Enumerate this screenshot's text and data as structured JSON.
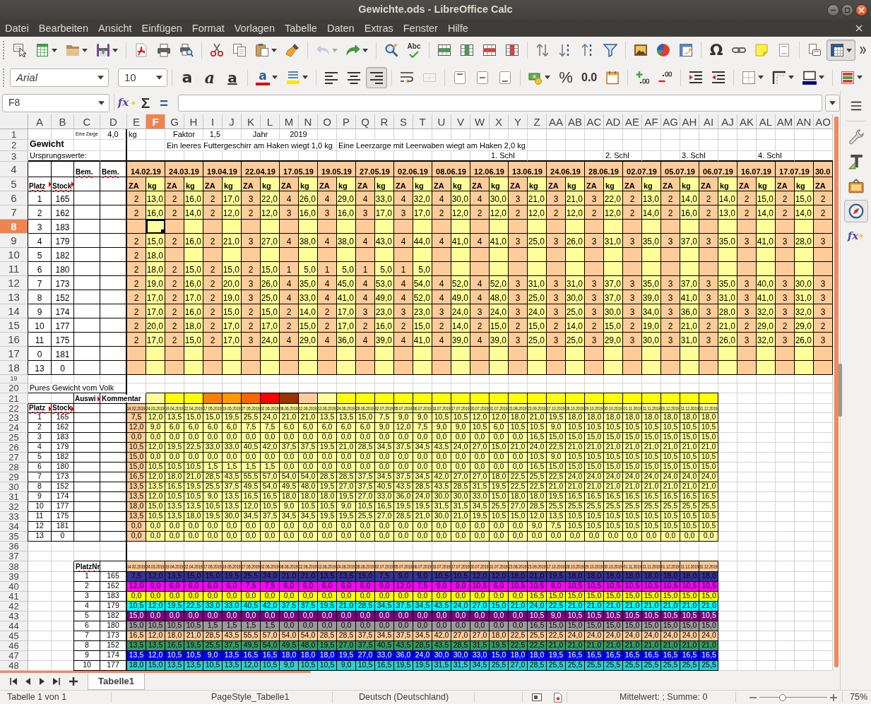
{
  "window": {
    "title": "Gewichte.ods - LibreOffice Calc"
  },
  "menu": [
    "Datei",
    "Bearbeiten",
    "Ansicht",
    "Einfügen",
    "Format",
    "Vorlagen",
    "Tabelle",
    "Daten",
    "Extras",
    "Fenster",
    "Hilfe"
  ],
  "standard_toolbar": {
    "undo": {
      "disabled": true
    },
    "redo": {
      "disabled": false
    },
    "spelling": {
      "label": "Abc"
    },
    "special_character": {
      "label": "Ω"
    },
    "freeze_panes": {
      "pressed": true
    }
  },
  "formatting_toolbar": {
    "font_name": "Arial",
    "font_size": "10",
    "bold": {
      "label": "a"
    },
    "italic": {
      "label": "a"
    },
    "underline": {
      "label": "a"
    },
    "font_color": {
      "label": "a"
    },
    "alignment": [
      {
        "pressed": false
      },
      {
        "pressed": false
      },
      {
        "pressed": true
      }
    ],
    "merge": {
      "disabled": true
    },
    "percent": {
      "label": "%"
    },
    "number": {
      "label": "0.0"
    }
  },
  "formula_bar": {
    "name_box": "F8",
    "function_wizard": {
      "label": "fx"
    },
    "sum": {
      "label": "Σ"
    },
    "function": {
      "label": "="
    }
  },
  "sheet": {
    "column_headers": [
      {
        "label": "A",
        "selected": false
      },
      {
        "label": "B",
        "selected": false
      },
      {
        "label": "C",
        "selected": false
      },
      {
        "label": "D",
        "selected": false
      },
      {
        "label": "E",
        "selected": false
      },
      {
        "label": "F",
        "selected": true
      },
      {
        "label": "G",
        "selected": false
      },
      {
        "label": "H",
        "selected": false
      },
      {
        "label": "I",
        "selected": false
      },
      {
        "label": "J",
        "selected": false
      },
      {
        "label": "K",
        "selected": false
      },
      {
        "label": "L",
        "selected": false
      },
      {
        "label": "M",
        "selected": false
      },
      {
        "label": "N",
        "selected": false
      },
      {
        "label": "O",
        "selected": false
      },
      {
        "label": "P",
        "selected": false
      },
      {
        "label": "Q",
        "selected": false
      },
      {
        "label": "R",
        "selected": false
      },
      {
        "label": "S",
        "selected": false
      },
      {
        "label": "T",
        "selected": false
      },
      {
        "label": "U",
        "selected": false
      },
      {
        "label": "V",
        "selected": false
      },
      {
        "label": "W",
        "selected": false
      },
      {
        "label": "X",
        "selected": false
      },
      {
        "label": "Y",
        "selected": false
      },
      {
        "label": "Z",
        "selected": false
      },
      {
        "label": "AA",
        "selected": false
      },
      {
        "label": "AB",
        "selected": false
      },
      {
        "label": "AC",
        "selected": false
      },
      {
        "label": "AD",
        "selected": false
      },
      {
        "label": "AE",
        "selected": false
      },
      {
        "label": "AF",
        "selected": false
      },
      {
        "label": "AG",
        "selected": false
      },
      {
        "label": "AH",
        "selected": false
      },
      {
        "label": "AI",
        "selected": false
      },
      {
        "label": "AJ",
        "selected": false
      },
      {
        "label": "AK",
        "selected": false
      },
      {
        "label": "AL",
        "selected": false
      },
      {
        "label": "AM",
        "selected": false
      },
      {
        "label": "AN",
        "selected": false
      },
      {
        "label": "AO",
        "selected": false
      }
    ],
    "row_headers": [
      {
        "label": "1",
        "selected": false
      },
      {
        "label": "2",
        "selected": false
      },
      {
        "label": "3",
        "selected": false
      },
      {
        "label": "4",
        "selected": false
      },
      {
        "label": "5",
        "selected": false
      },
      {
        "label": "6",
        "selected": false
      },
      {
        "label": "7",
        "selected": false
      },
      {
        "label": "8",
        "selected": true
      },
      {
        "label": "9",
        "selected": false
      },
      {
        "label": "10",
        "selected": false
      },
      {
        "label": "11",
        "selected": false
      },
      {
        "label": "12",
        "selected": false
      },
      {
        "label": "13",
        "selected": false
      },
      {
        "label": "14",
        "selected": false
      },
      {
        "label": "15",
        "selected": false
      },
      {
        "label": "16",
        "selected": false
      },
      {
        "label": "17",
        "selected": false
      },
      {
        "label": "18",
        "selected": false
      },
      {
        "label": "19",
        "selected": false
      },
      {
        "label": "20",
        "selected": false
      },
      {
        "label": "21",
        "selected": false
      },
      {
        "label": "22",
        "selected": false
      },
      {
        "label": "23",
        "selected": false
      },
      {
        "label": "24",
        "selected": false
      },
      {
        "label": "25",
        "selected": false
      },
      {
        "label": "26",
        "selected": false
      },
      {
        "label": "27",
        "selected": false
      },
      {
        "label": "28",
        "selected": false
      },
      {
        "label": "29",
        "selected": false
      },
      {
        "label": "30",
        "selected": false
      },
      {
        "label": "31",
        "selected": false
      },
      {
        "label": "32",
        "selected": false
      },
      {
        "label": "33",
        "selected": false
      },
      {
        "label": "34",
        "selected": false
      },
      {
        "label": "35",
        "selected": false
      },
      {
        "label": "36",
        "selected": false
      },
      {
        "label": "37",
        "selected": false
      },
      {
        "label": "38",
        "selected": false
      },
      {
        "label": "39",
        "selected": false
      },
      {
        "label": "40",
        "selected": false
      },
      {
        "label": "41",
        "selected": false
      },
      {
        "label": "42",
        "selected": false
      },
      {
        "label": "43",
        "selected": false
      },
      {
        "label": "44",
        "selected": false
      },
      {
        "label": "45",
        "selected": false
      },
      {
        "label": "46",
        "selected": false
      },
      {
        "label": "47",
        "selected": false
      },
      {
        "label": "48",
        "selected": false
      }
    ],
    "info": {
      "zarge": {
        "label": "Eine Zarge",
        "value": "4,0",
        "unit": "kg"
      },
      "factor": {
        "label": "Faktor",
        "value": "1,5"
      },
      "year": {
        "label": "Jahr",
        "value": "2019"
      },
      "title": "Gewicht",
      "notes": [
        "Ein leeres Futtergeschirr am Haken wiegt 1,0 kg",
        "Eine Leerzarge mit Leerwaben wiegt am Haken 2,0 kg"
      ],
      "origin_label": "Ursprungswerte:",
      "markers": [
        "1. Schl",
        "2. Schl",
        "3. Schl",
        "4. Schl"
      ]
    },
    "weights": {
      "remark_headers": [
        {
          "text": "Bem.",
          "misspelled": true,
          "clipped": false
        },
        {
          "text": "Bem.",
          "misspelled": true,
          "clipped": false
        }
      ],
      "dates": [
        "14.02.19",
        "24.03.19",
        "19.04.19",
        "22.04.19",
        "17.05.19",
        "19.05.19",
        "27.05.19",
        "02.06.19",
        "08.06.19",
        "12.06.19",
        "13.06.19",
        "24.06.19",
        "28.06.19",
        "02.07.19",
        "05.07.19",
        "06.07.19",
        "16.07.19",
        "17.07.19",
        "30.0"
      ],
      "key_headers": [
        {
          "text": "Platz",
          "misspelled": true,
          "clipped": true
        },
        {
          "text": "Stock",
          "misspelled": true,
          "clipped": true
        }
      ],
      "units": [
        "ZA",
        "kg",
        "ZA",
        "kg",
        "ZA",
        "kg",
        "ZA",
        "kg",
        "ZA",
        "kg",
        "ZA",
        "kg",
        "ZA",
        "kg",
        "ZA",
        "kg",
        "ZA",
        "kg",
        "ZA",
        "kg",
        "ZA",
        "kg",
        "ZA",
        "kg",
        "ZA",
        "kg",
        "ZA",
        "kg",
        "ZA",
        "kg",
        "ZA",
        "kg",
        "ZA",
        "kg",
        "ZA",
        "kg",
        "ZA"
      ],
      "rows": [
        {
          "platz": "1",
          "stock": "165",
          "values": [
            "2",
            "13,0",
            "2",
            "16,0",
            "2",
            "17,0",
            "3",
            "22,0",
            "4",
            "26,0",
            "4",
            "29,0",
            "4",
            "33,0",
            "4",
            "32,0",
            "4",
            "30,0",
            "4",
            "30,0",
            "3",
            "21,0",
            "3",
            "21,0",
            "3",
            "22,0",
            "2",
            "13,0",
            "2",
            "14,0",
            "2",
            "14,0",
            "2",
            "15,0",
            "2",
            "15,0",
            "2"
          ]
        },
        {
          "platz": "2",
          "stock": "162",
          "values": [
            "2",
            "16,0",
            "2",
            "14,0",
            "2",
            "12,0",
            "2",
            "12,0",
            "3",
            "16,0",
            "3",
            "16,0",
            "3",
            "17,0",
            "3",
            "17,0",
            "2",
            "12,0",
            "2",
            "12,0",
            "2",
            "12,0",
            "2",
            "12,0",
            "2",
            "12,0",
            "2",
            "14,0",
            "2",
            "16,0",
            "2",
            "13,0",
            "2",
            "14,0",
            "2",
            "14,0",
            "2"
          ]
        },
        {
          "platz": "3",
          "stock": "183"
        },
        {
          "platz": "4",
          "stock": "179",
          "values": [
            "2",
            "15,0",
            "2",
            "16,0",
            "2",
            "21,0",
            "3",
            "27,0",
            "4",
            "38,0",
            "4",
            "38,0",
            "4",
            "43,0",
            "4",
            "44,0",
            "4",
            "41,0",
            "4",
            "41,0",
            "3",
            "25,0",
            "3",
            "26,0",
            "3",
            "31,0",
            "3",
            "35,0",
            "3",
            "37,0",
            "3",
            "35,0",
            "3",
            "41,0",
            "3",
            "28,0",
            "3"
          ]
        },
        {
          "platz": "5",
          "stock": "182",
          "values": [
            "2",
            "18,0"
          ]
        },
        {
          "platz": "6",
          "stock": "180",
          "values": [
            "2",
            "18,0",
            "2",
            "15,0",
            "2",
            "15,0",
            "2",
            "15,0",
            "1",
            "5,0",
            "1",
            "5,0",
            "1",
            "5,0",
            "1",
            "5,0"
          ]
        },
        {
          "platz": "7",
          "stock": "173",
          "values": [
            "2",
            "19,0",
            "2",
            "16,0",
            "2",
            "20,0",
            "3",
            "26,0",
            "4",
            "35,0",
            "4",
            "45,0",
            "4",
            "53,0",
            "4",
            "54,0",
            "4",
            "52,0",
            "4",
            "52,0",
            "3",
            "31,0",
            "3",
            "31,0",
            "3",
            "37,0",
            "3",
            "35,0",
            "3",
            "37,0",
            "3",
            "35,0",
            "3",
            "40,0",
            "3",
            "30,0",
            "3"
          ]
        },
        {
          "platz": "8",
          "stock": "152",
          "values": [
            "2",
            "17,0",
            "2",
            "17,0",
            "2",
            "19,0",
            "3",
            "25,0",
            "4",
            "33,0",
            "4",
            "41,0",
            "4",
            "49,0",
            "4",
            "52,0",
            "4",
            "49,0",
            "4",
            "48,0",
            "3",
            "25,0",
            "3",
            "30,0",
            "3",
            "37,0",
            "3",
            "39,0",
            "3",
            "41,0",
            "3",
            "31,0",
            "3",
            "41,0",
            "3",
            "31,0",
            "3"
          ]
        },
        {
          "platz": "9",
          "stock": "174",
          "values": [
            "2",
            "17,0",
            "2",
            "16,0",
            "2",
            "15,0",
            "2",
            "15,0",
            "2",
            "14,0",
            "2",
            "17,0",
            "3",
            "23,0",
            "3",
            "23,0",
            "3",
            "24,0",
            "3",
            "24,0",
            "3",
            "24,0",
            "3",
            "25,0",
            "3",
            "30,0",
            "3",
            "34,0",
            "3",
            "36,0",
            "3",
            "28,0",
            "3",
            "32,0",
            "3",
            "32,0",
            "3"
          ]
        },
        {
          "platz": "10",
          "stock": "177",
          "values": [
            "2",
            "20,0",
            "2",
            "18,0",
            "2",
            "17,0",
            "2",
            "17,0",
            "2",
            "15,0",
            "2",
            "17,0",
            "2",
            "16,0",
            "2",
            "15,0",
            "2",
            "14,0",
            "2",
            "15,0",
            "2",
            "15,0",
            "2",
            "14,0",
            "2",
            "15,0",
            "2",
            "19,0",
            "2",
            "21,0",
            "2",
            "21,0",
            "2",
            "29,0",
            "2",
            "29,0",
            "2"
          ]
        },
        {
          "platz": "11",
          "stock": "175",
          "values": [
            "2",
            "17,0",
            "2",
            "15,0",
            "2",
            "17,0",
            "3",
            "24,0",
            "4",
            "29,0",
            "4",
            "36,0",
            "4",
            "39,0",
            "4",
            "41,0",
            "4",
            "39,0",
            "4",
            "39,0",
            "3",
            "25,0",
            "3",
            "25,0",
            "3",
            "29,0",
            "3",
            "30,0",
            "3",
            "31,0",
            "3",
            "26,0",
            "3",
            "32,0",
            "3",
            "26,0",
            "3"
          ]
        },
        {
          "platz": "0",
          "stock": "181"
        },
        {
          "platz": "13",
          "stock": "0"
        }
      ]
    },
    "net": {
      "title": "Pures Gewicht vom Volk",
      "comment_headers": [
        {
          "text": "Auswi",
          "misspelled": false,
          "clipped": true
        },
        {
          "text": "Kommentar",
          "misspelled": false,
          "clipped": false
        }
      ],
      "color_cells": [
        {
          "color": "#ffff99"
        },
        {
          "color": "#ffff00"
        },
        {
          "color": "#ffff00"
        },
        {
          "color": "#ff8000"
        },
        {
          "color": "#ff9900"
        },
        {
          "color": "#ff6600"
        },
        {
          "color": "#ff0000"
        },
        {
          "color": "#993300"
        },
        {
          "color": "#ffcc99"
        },
        {
          "color": "#ffff99"
        },
        {
          "color": "#ffff00"
        },
        {
          "color": "#ffff00"
        },
        {
          "color": "#ffff00"
        },
        {
          "color": "#ffff00"
        },
        {
          "color": "#ffff00"
        },
        {
          "color": "#ffff00"
        },
        {
          "color": "#ffff00"
        },
        {
          "color": "#ffff00"
        },
        {
          "color": "#ffff00"
        },
        {
          "color": "#ffff00"
        },
        {
          "color": "#ffff00"
        },
        {
          "color": "#ffff00"
        },
        {
          "color": "#ffff00"
        },
        {
          "color": "#ffff00"
        },
        {
          "color": "#ffff00"
        },
        {
          "color": "#ffff00"
        },
        {
          "color": "#ffff00"
        },
        {
          "color": "#ffff00"
        },
        {
          "color": "#ffff00"
        },
        {
          "color": "#ffff00"
        }
      ],
      "key_headers": [
        {
          "text": "Platz",
          "misspelled": true,
          "clipped": true
        },
        {
          "text": "Stock",
          "misspelled": true,
          "clipped": true
        }
      ],
      "dates": [
        "14.02.2019",
        "24.03.2019",
        "19.04.2019",
        "22.04.2019",
        "17.05.2019",
        "19.05.2019",
        "27.05.2019",
        "02.06.2019",
        "08.06.2019",
        "12.06.2019",
        "13.06.2019",
        "24.06.2019",
        "28.06.2019",
        "02.07.2019",
        "05.07.2019",
        "06.07.2019",
        "16.07.2019",
        "17.07.2019",
        "30.07.2019",
        "31.07.2019",
        "23.08.2019",
        "23.09.2019",
        "17.10.2019",
        "28.10.2019",
        "29.10.2019",
        "30.10.2019",
        "01.11.2019",
        "11.11.2019",
        "01.12.2019",
        "11.12.2019",
        "31.12.2019"
      ],
      "rows": [
        {
          "platz": "1",
          "stock": "165",
          "values": [
            "7,5",
            "12,0",
            "13,5",
            "15,0",
            "15,0",
            "19,5",
            "25,5",
            "24,0",
            "21,0",
            "21,0",
            "13,5",
            "13,5",
            "15,0",
            "7,5",
            "9,0",
            "9,0",
            "10,5",
            "10,5",
            "12,0",
            "12,0",
            "18,0",
            "21,0",
            "19,5",
            "18,0",
            "18,0",
            "18,0",
            "18,0",
            "18,0",
            "18,0",
            "18,0",
            "18,0"
          ]
        },
        {
          "platz": "2",
          "stock": "162",
          "values": [
            "12,0",
            "9,0",
            "6,0",
            "6,0",
            "6,0",
            "6,0",
            "7,5",
            "7,5",
            "6,0",
            "6,0",
            "6,0",
            "6,0",
            "6,0",
            "9,0",
            "12,0",
            "7,5",
            "9,0",
            "9,0",
            "10,5",
            "6,0",
            "10,5",
            "10,5",
            "9,0",
            "10,5",
            "10,5",
            "10,5",
            "10,5",
            "10,5",
            "10,5",
            "10,5",
            "10,5"
          ]
        },
        {
          "platz": "3",
          "stock": "183",
          "values": [
            "0,0",
            "0,0",
            "0,0",
            "0,0",
            "0,0",
            "0,0",
            "0,0",
            "0,0",
            "0,0",
            "0,0",
            "0,0",
            "0,0",
            "0,0",
            "0,0",
            "0,0",
            "0,0",
            "0,0",
            "0,0",
            "0,0",
            "0,0",
            "0,0",
            "16,5",
            "15,0",
            "15,0",
            "15,0",
            "15,0",
            "15,0",
            "15,0",
            "15,0",
            "15,0",
            "15,0"
          ]
        },
        {
          "platz": "4",
          "stock": "179",
          "values": [
            "10,5",
            "12,0",
            "19,5",
            "22,5",
            "33,0",
            "33,0",
            "40,5",
            "42,0",
            "37,5",
            "37,5",
            "19,5",
            "21,0",
            "28,5",
            "34,5",
            "37,5",
            "34,5",
            "43,5",
            "24,0",
            "27,0",
            "15,0",
            "21,0",
            "24,0",
            "22,5",
            "21,0",
            "21,0",
            "21,0",
            "21,0",
            "21,0",
            "21,0",
            "21,0",
            "21,0"
          ]
        },
        {
          "platz": "5",
          "stock": "182",
          "values": [
            "15,0",
            "0,0",
            "0,0",
            "0,0",
            "0,0",
            "0,0",
            "0,0",
            "0,0",
            "0,0",
            "0,0",
            "0,0",
            "0,0",
            "0,0",
            "0,0",
            "0,0",
            "0,0",
            "0,0",
            "0,0",
            "0,0",
            "0,0",
            "0,0",
            "10,5",
            "9,0",
            "10,5",
            "10,5",
            "10,5",
            "10,5",
            "10,5",
            "10,5",
            "10,5",
            "10,5"
          ]
        },
        {
          "platz": "6",
          "stock": "180",
          "values": [
            "15,0",
            "10,5",
            "10,5",
            "10,5",
            "1,5",
            "1,5",
            "1,5",
            "1,5",
            "0,0",
            "0,0",
            "0,0",
            "0,0",
            "0,0",
            "0,0",
            "0,0",
            "0,0",
            "0,0",
            "0,0",
            "0,0",
            "0,0",
            "0,0",
            "16,5",
            "15,0",
            "15,0",
            "15,0",
            "15,0",
            "15,0",
            "15,0",
            "15,0",
            "15,0",
            "15,0"
          ]
        },
        {
          "platz": "7",
          "stock": "173",
          "values": [
            "16,5",
            "12,0",
            "18,0",
            "21,0",
            "28,5",
            "43,5",
            "55,5",
            "57,0",
            "54,0",
            "54,0",
            "28,5",
            "28,5",
            "37,5",
            "34,5",
            "37,5",
            "34,5",
            "42,0",
            "27,0",
            "27,0",
            "18,0",
            "22,5",
            "25,5",
            "22,5",
            "24,0",
            "24,0",
            "24,0",
            "24,0",
            "24,0",
            "24,0",
            "24,0",
            "24,0"
          ]
        },
        {
          "platz": "8",
          "stock": "152",
          "values": [
            "13,5",
            "13,5",
            "16,5",
            "19,5",
            "25,5",
            "37,5",
            "49,5",
            "54,0",
            "49,5",
            "48,0",
            "19,5",
            "27,0",
            "37,5",
            "40,5",
            "43,5",
            "28,5",
            "43,5",
            "28,5",
            "31,5",
            "19,5",
            "22,5",
            "22,5",
            "21,0",
            "21,0",
            "21,0",
            "21,0",
            "21,0",
            "21,0",
            "21,0",
            "21,0",
            "21,0"
          ]
        },
        {
          "platz": "9",
          "stock": "174",
          "values": [
            "13,5",
            "12,0",
            "10,5",
            "10,5",
            "9,0",
            "13,5",
            "16,5",
            "16,5",
            "18,0",
            "18,0",
            "18,0",
            "19,5",
            "27,0",
            "33,0",
            "36,0",
            "24,0",
            "30,0",
            "30,0",
            "33,0",
            "15,0",
            "18,0",
            "18,0",
            "19,5",
            "16,5",
            "16,5",
            "16,5",
            "16,5",
            "16,5",
            "16,5",
            "16,5",
            "16,5"
          ]
        },
        {
          "platz": "10",
          "stock": "177",
          "values": [
            "18,0",
            "15,0",
            "13,5",
            "13,5",
            "10,5",
            "13,5",
            "12,0",
            "10,5",
            "9,0",
            "10,5",
            "10,5",
            "9,0",
            "10,5",
            "16,5",
            "19,5",
            "19,5",
            "31,5",
            "31,5",
            "34,5",
            "25,5",
            "27,0",
            "28,5",
            "25,5",
            "25,5",
            "25,5",
            "25,5",
            "25,5",
            "25,5",
            "25,5",
            "25,5",
            "25,5"
          ]
        },
        {
          "platz": "11",
          "stock": "175",
          "values": [
            "13,5",
            "10,5",
            "13,5",
            "18,0",
            "19,5",
            "30,0",
            "34,5",
            "37,5",
            "34,5",
            "34,5",
            "19,5",
            "19,5",
            "25,5",
            "27,0",
            "28,5",
            "21,0",
            "30,0",
            "21,0",
            "19,5",
            "10,5",
            "15,0",
            "12,0",
            "13,5",
            "10,5",
            "10,5",
            "10,5",
            "10,5",
            "10,5",
            "10,5",
            "10,5",
            "10,5"
          ]
        },
        {
          "platz": "12",
          "stock": "181",
          "values": [
            "0,0",
            "0,0",
            "0,0",
            "0,0",
            "0,0",
            "0,0",
            "0,0",
            "0,0",
            "0,0",
            "0,0",
            "0,0",
            "0,0",
            "0,0",
            "0,0",
            "0,0",
            "0,0",
            "0,0",
            "0,0",
            "0,0",
            "0,0",
            "0,0",
            "9,0",
            "7,5",
            "10,5",
            "10,5",
            "10,5",
            "10,5",
            "10,5",
            "10,5",
            "10,5",
            "10,5"
          ]
        },
        {
          "platz": "13",
          "stock": "0",
          "values": [
            "0,0",
            "0,0",
            "0,0",
            "0,0",
            "0,0",
            "0,0",
            "0,0",
            "0,0",
            "0,0",
            "0,0",
            "0,0",
            "0,0",
            "0,0",
            "0,0",
            "0,0",
            "0,0",
            "0,0",
            "0,0",
            "0,0",
            "0,0",
            "0,0",
            "0,0",
            "0,0",
            "0,0",
            "0,0",
            "0,0",
            "0,0",
            "0,0",
            "0,0",
            "0,0",
            "0,0"
          ]
        }
      ]
    },
    "colored": {
      "key_header": {
        "text": "PlatzNr",
        "misspelled": true,
        "clipped": false
      },
      "dates": [
        "14.02.2019",
        "24.03.2019",
        "19.04.2019",
        "22.04.2019",
        "17.05.2019",
        "19.05.2019",
        "27.05.2019",
        "02.06.2019",
        "08.06.2019",
        "12.06.2019",
        "13.06.2019",
        "24.06.2019",
        "28.06.2019",
        "02.07.2019",
        "05.07.2019",
        "06.07.2019",
        "16.07.2019",
        "17.07.2019",
        "30.07.2019",
        "31.07.2019",
        "23.08.2019",
        "23.09.2019",
        "17.10.2019",
        "28.10.2019",
        "29.10.2019",
        "30.10.2019",
        "01.11.2019",
        "11.11.2019",
        "01.12.2019",
        "11.12.2019",
        "31.12.2019"
      ],
      "rows": [
        {
          "platz": "1",
          "stock": "165",
          "color": "#333399",
          "values": [
            "7,5",
            "12,0",
            "13,5",
            "15,0",
            "15,0",
            "19,5",
            "25,5",
            "24,0",
            "21,0",
            "21,0",
            "13,5",
            "13,5",
            "15,0",
            "7,5",
            "9,0",
            "9,0",
            "10,5",
            "10,5",
            "12,0",
            "12,0",
            "18,0",
            "21,0",
            "19,5",
            "18,0",
            "18,0",
            "18,0",
            "18,0",
            "18,0",
            "18,0",
            "18,0",
            "18,0"
          ]
        },
        {
          "platz": "2",
          "stock": "162",
          "color": "#ff00ff",
          "values": [
            "12,0",
            "9,0",
            "6,0",
            "6,0",
            "6,0",
            "6,0",
            "7,5",
            "7,5",
            "6,0",
            "6,0",
            "6,0",
            "6,0",
            "6,0",
            "9,0",
            "12,0",
            "7,5",
            "9,0",
            "9,0",
            "10,5",
            "6,0",
            "10,5",
            "10,5",
            "9,0",
            "10,5",
            "10,5",
            "10,5",
            "10,5",
            "10,5",
            "10,5",
            "10,5",
            "10,5"
          ]
        },
        {
          "platz": "3",
          "stock": "183",
          "color": "#ffff00",
          "values": [
            "0,0",
            "0,0",
            "0,0",
            "0,0",
            "0,0",
            "0,0",
            "0,0",
            "0,0",
            "0,0",
            "0,0",
            "0,0",
            "0,0",
            "0,0",
            "0,0",
            "0,0",
            "0,0",
            "0,0",
            "0,0",
            "0,0",
            "0,0",
            "0,0",
            "16,5",
            "15,0",
            "15,0",
            "15,0",
            "15,0",
            "15,0",
            "15,0",
            "15,0",
            "15,0",
            "15,0"
          ]
        },
        {
          "platz": "4",
          "stock": "179",
          "color": "#00ffff",
          "values": [
            "10,5",
            "12,0",
            "19,5",
            "22,5",
            "33,0",
            "33,0",
            "40,5",
            "42,0",
            "37,5",
            "37,5",
            "19,5",
            "21,0",
            "28,5",
            "34,5",
            "37,5",
            "34,5",
            "43,5",
            "24,0",
            "27,0",
            "15,0",
            "21,0",
            "24,0",
            "22,5",
            "21,0",
            "21,0",
            "21,0",
            "21,0",
            "21,0",
            "21,0",
            "21,0",
            "21,0"
          ]
        },
        {
          "platz": "5",
          "stock": "182",
          "color": "#800080",
          "values": [
            "15,0",
            "0,0",
            "0,0",
            "0,0",
            "0,0",
            "0,0",
            "0,0",
            "0,0",
            "0,0",
            "0,0",
            "0,0",
            "0,0",
            "0,0",
            "0,0",
            "0,0",
            "0,0",
            "0,0",
            "0,0",
            "0,0",
            "0,0",
            "0,0",
            "10,5",
            "9,0",
            "10,5",
            "10,5",
            "10,5",
            "10,5",
            "10,5",
            "10,5",
            "10,5",
            "10,5"
          ]
        },
        {
          "platz": "6",
          "stock": "180",
          "color": "#999999",
          "values": [
            "15,0",
            "10,5",
            "10,5",
            "10,5",
            "1,5",
            "1,5",
            "1,5",
            "1,5",
            "0,0",
            "0,0",
            "0,0",
            "0,0",
            "0,0",
            "0,0",
            "0,0",
            "0,0",
            "0,0",
            "0,0",
            "0,0",
            "0,0",
            "0,0",
            "16,5",
            "15,0",
            "15,0",
            "15,0",
            "15,0",
            "15,0",
            "15,0",
            "15,0",
            "15,0",
            "15,0"
          ]
        },
        {
          "platz": "7",
          "stock": "173",
          "color": "#ffcc99",
          "values": [
            "16,5",
            "12,0",
            "18,0",
            "21,0",
            "28,5",
            "43,5",
            "55,5",
            "57,0",
            "54,0",
            "54,0",
            "28,5",
            "28,5",
            "37,5",
            "34,5",
            "37,5",
            "34,5",
            "42,0",
            "27,0",
            "27,0",
            "18,0",
            "22,5",
            "25,5",
            "22,5",
            "24,0",
            "24,0",
            "24,0",
            "24,0",
            "24,0",
            "24,0",
            "24,0",
            "24,0"
          ]
        },
        {
          "platz": "8",
          "stock": "152",
          "color": "#339966",
          "values": [
            "13,5",
            "13,5",
            "16,5",
            "19,5",
            "25,5",
            "37,5",
            "49,5",
            "54,0",
            "49,5",
            "48,0",
            "19,5",
            "27,0",
            "37,5",
            "40,5",
            "43,5",
            "28,5",
            "43,5",
            "28,5",
            "31,5",
            "19,5",
            "22,5",
            "22,5",
            "21,0",
            "21,0",
            "21,0",
            "21,0",
            "21,0",
            "21,0",
            "21,0",
            "21,0",
            "21,0"
          ]
        },
        {
          "platz": "9",
          "stock": "174",
          "color": "#0000ff",
          "values": [
            "13,5",
            "12,0",
            "10,5",
            "10,5",
            "9,0",
            "13,5",
            "16,5",
            "16,5",
            "18,0",
            "18,0",
            "18,0",
            "19,5",
            "27,0",
            "33,0",
            "36,0",
            "24,0",
            "30,0",
            "30,0",
            "33,0",
            "15,0",
            "18,0",
            "18,0",
            "19,5",
            "16,5",
            "16,5",
            "16,5",
            "16,5",
            "16,5",
            "16,5",
            "16,5",
            "16,5"
          ]
        },
        {
          "platz": "10",
          "stock": "177",
          "color": "#33cccc",
          "values": [
            "18,0",
            "15,0",
            "13,5",
            "13,5",
            "10,5",
            "13,5",
            "12,0",
            "10,5",
            "9,0",
            "10,5",
            "10,5",
            "9,0",
            "10,5",
            "16,5",
            "19,5",
            "19,5",
            "31,5",
            "31,5",
            "34,5",
            "25,5",
            "27,0",
            "28,5",
            "25,5",
            "25,5",
            "25,5",
            "25,5",
            "25,5",
            "25,5",
            "25,5",
            "25,5",
            "25,5"
          ]
        }
      ]
    }
  },
  "sheet_tabs": [
    {
      "label": "Tabelle1",
      "selected": true
    }
  ],
  "sidebar": {
    "buttons": [
      {
        "selected": false
      },
      {
        "selected": false
      },
      {
        "selected": false
      },
      {
        "selected": true
      },
      {
        "selected": false,
        "label": "fx"
      }
    ]
  },
  "status_bar": {
    "sheet_position": "Tabelle 1 von 1",
    "page_style": "PageStyle_Tabelle1",
    "language": "Deutsch (Deutschland)",
    "document_modified": true,
    "selection_summary": "Mittelwert: ; Summe: 0",
    "zoom_slider": {
      "level": 0.32
    },
    "zoom": "75%"
  }
}
